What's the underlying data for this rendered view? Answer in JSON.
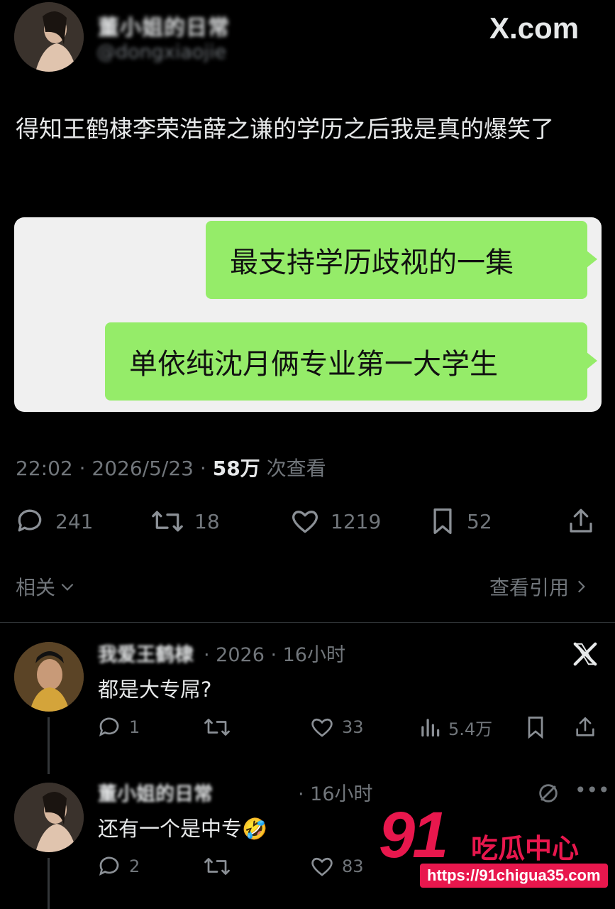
{
  "header": {
    "name": "董小姐的日常",
    "handle": "@dongxiaojie",
    "site": "X.com"
  },
  "tweet": {
    "text": "得知王鹤棣李荣浩薛之谦的学历之后我是真的爆笑了",
    "chat_bubbles": [
      "最支持学历歧视的一集",
      "单依纯沈月俩专业第一大学生"
    ],
    "time": "22:02",
    "date": "2026/5/23",
    "views": "58万",
    "views_label": "次查看",
    "dot": "·"
  },
  "actions": {
    "replies": "241",
    "retweets": "18",
    "likes": "1219",
    "bookmarks": "52"
  },
  "related": {
    "left": "相关",
    "right": "查看引用"
  },
  "replies": [
    {
      "name": "我爱王鹤棣",
      "meta": "· 2026 · 16小时",
      "text": "都是大专屌?",
      "replies": "1",
      "retweets": "",
      "likes": "33",
      "views": "5.4万"
    },
    {
      "name": "董小姐的日常",
      "meta": "· 16小时",
      "text": "还有一个是中专🤣",
      "replies": "2",
      "retweets": "",
      "likes": "83"
    }
  ],
  "watermark": {
    "number": "91",
    "brand": "吃瓜中心",
    "url": "https://91chigua35.com"
  },
  "colors": {
    "background": "#000000",
    "bubble": "#95ec69",
    "watermark": "#e8174d"
  }
}
